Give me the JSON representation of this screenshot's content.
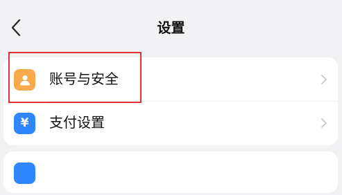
{
  "header": {
    "title": "设置",
    "back_icon": "chevron-left-icon"
  },
  "settings": {
    "group1": [
      {
        "label": "账号与安全",
        "icon": "user-icon",
        "icon_color": "#f7a94b"
      },
      {
        "label": "支付设置",
        "icon": "yen-icon",
        "icon_color": "#2f86ff"
      }
    ],
    "group2_peek": {
      "label": "",
      "icon_color": "#2f86ff"
    }
  },
  "annotation": {
    "color": "#e0313a"
  },
  "colors": {
    "background": "#f2f2f4",
    "card": "#ffffff",
    "chevron": "#c5c7cc"
  },
  "icons": {
    "yen_glyph": "¥"
  }
}
